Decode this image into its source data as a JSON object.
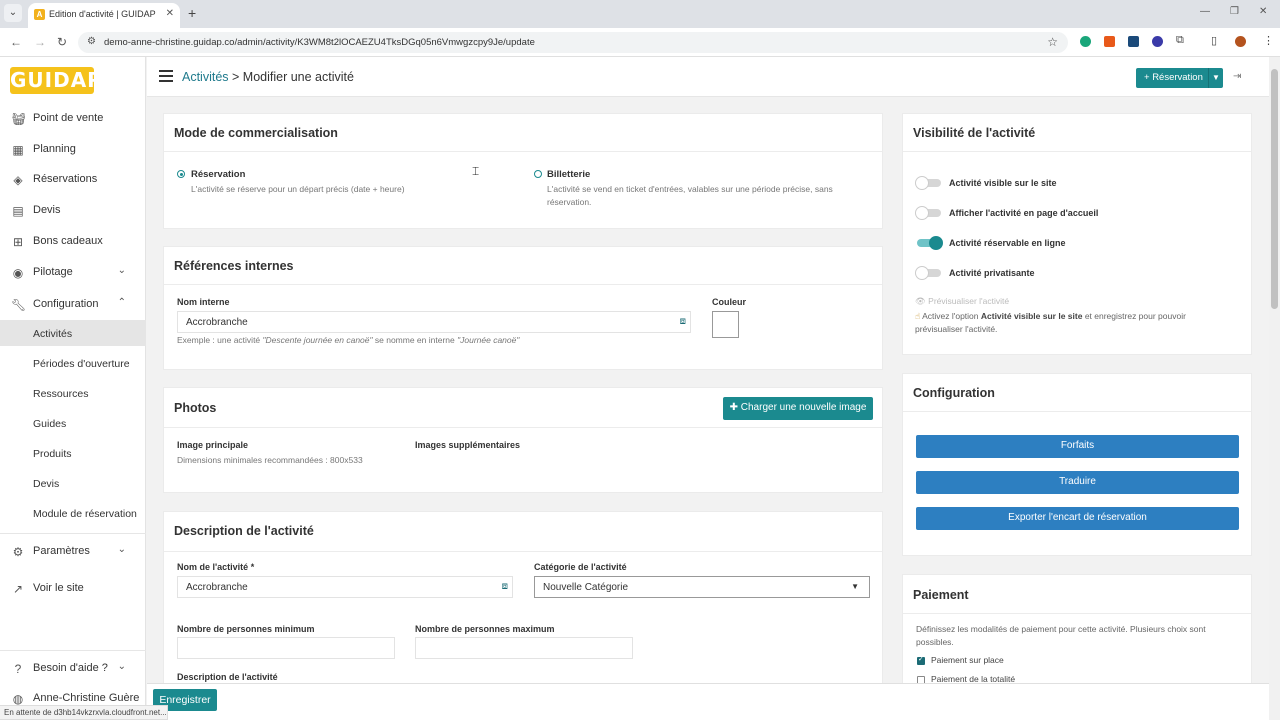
{
  "browser": {
    "tab_title": "Edition d'activité | GUIDAP",
    "url": "demo-anne-christine.guidap.co/admin/activity/K3WM8t2lOCAEZU4TksDGq05n6Vmwgzcpy9Je/update",
    "status_text": "En attente de d3hb14vkzrxvla.cloudfront.net...",
    "colors": {
      "tabbar": "#dee1e6",
      "favicon": "#f2b11c"
    }
  },
  "sidebar": {
    "logo_text": "GUIDAP",
    "items": [
      {
        "label": "Point de vente",
        "icon": "basket-icon"
      },
      {
        "label": "Planning",
        "icon": "calendar-icon"
      },
      {
        "label": "Réservations",
        "icon": "tag-icon"
      },
      {
        "label": "Devis",
        "icon": "document-icon"
      },
      {
        "label": "Bons cadeaux",
        "icon": "gift-icon"
      },
      {
        "label": "Pilotage",
        "icon": "gauge-icon"
      },
      {
        "label": "Configuration",
        "icon": "wrench-icon"
      }
    ],
    "config_sub": [
      "Activités",
      "Périodes d'ouverture",
      "Ressources",
      "Guides",
      "Produits",
      "Devis",
      "Module de réservation"
    ],
    "params_label": "Paramètres",
    "voir_site_label": "Voir le site",
    "help_label": "Besoin d'aide ?",
    "user_name": "Anne-Christine Guère"
  },
  "topbar": {
    "breadcrumb_link": "Activités",
    "breadcrumb_sep": " > ",
    "breadcrumb_current": "Modifier une activité",
    "reservation_btn": "Réservation"
  },
  "commercialisation": {
    "title": "Mode de commercialisation",
    "option1_label": "Réservation",
    "option1_desc": "L'activité se réserve pour un départ précis (date + heure)",
    "option2_label": "Billetterie",
    "option2_desc": "L'activité se vend en ticket d'entrées, valables sur une période précise, sans réservation."
  },
  "references": {
    "title": "Références internes",
    "nom_label": "Nom interne",
    "nom_value": "Accrobranche",
    "couleur_label": "Couleur",
    "hint_prefix": "Exemple : une activité ",
    "hint_em1": "\"Descente journée en canoë\"",
    "hint_mid": " se nomme en interne ",
    "hint_em2": "\"Journée canoë\""
  },
  "photos": {
    "title": "Photos",
    "upload_btn": "Charger une nouvelle image",
    "main_label": "Image principale",
    "main_hint": "Dimensions minimales recommandées : 800x533",
    "extra_label": "Images supplémentaires"
  },
  "description": {
    "title": "Description de l'activité",
    "nom_label": "Nom de l'activité",
    "nom_required": "*",
    "nom_value": "Accrobranche",
    "cat_label": "Catégorie de l'activité",
    "cat_value": "Nouvelle Catégorie",
    "min_label": "Nombre de personnes minimum",
    "max_label": "Nombre de personnes maximum",
    "desc_label": "Description de l'activité"
  },
  "visibilite": {
    "title": "Visibilité de l'activité",
    "toggles": [
      {
        "label": "Activité visible sur le site",
        "on": false
      },
      {
        "label": "Afficher l'activité en page d'accueil",
        "on": false
      },
      {
        "label": "Activité réservable en ligne",
        "on": true
      },
      {
        "label": "Activité privatisante",
        "on": false
      }
    ],
    "preview_label": "Prévisualiser l'activité",
    "note_prefix": "Activez l'option ",
    "note_bold": "Activité visible sur le site",
    "note_suffix": " et enregistrez pour pouvoir prévisualiser l'activité."
  },
  "configuration": {
    "title": "Configuration",
    "buttons": [
      "Forfaits",
      "Traduire",
      "Exporter l'encart de réservation"
    ]
  },
  "paiement": {
    "title": "Paiement",
    "desc": "Définissez les modalités de paiement pour cette activité. Plusieurs choix sont possibles.",
    "options": [
      {
        "label": "Paiement sur place",
        "checked": true
      },
      {
        "label": "Paiement de la totalité",
        "checked": false
      }
    ]
  },
  "footer": {
    "save_label": "Enregistrer"
  },
  "colors": {
    "accent": "#1b8a8f",
    "blue": "#2d7fc1",
    "link": "#1f7a8c",
    "logo": "#f5c21b"
  }
}
